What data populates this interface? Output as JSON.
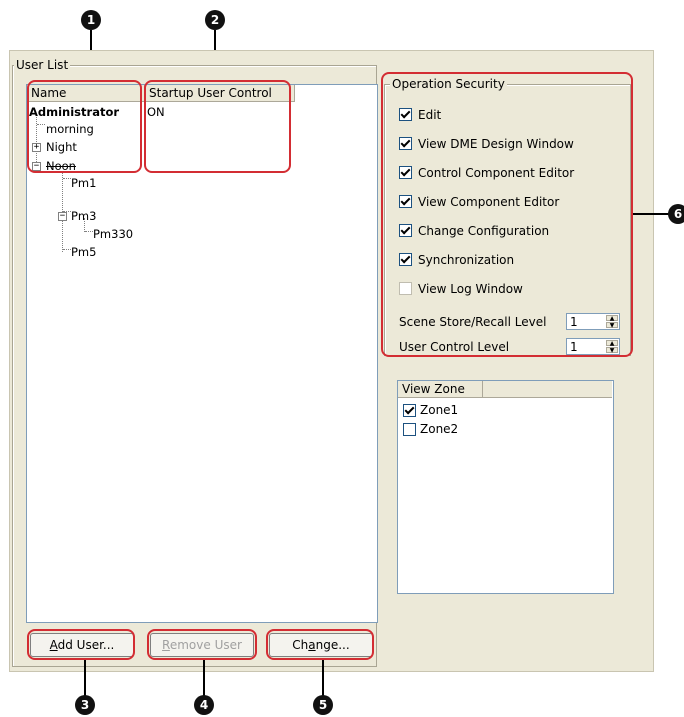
{
  "callouts": [
    "1",
    "2",
    "3",
    "4",
    "5",
    "6"
  ],
  "user_list": {
    "legend": "User List",
    "columns": [
      "Name",
      "Startup User Control"
    ],
    "rows": [
      {
        "name": "Administrator",
        "startup": "ON"
      },
      {
        "name": "morning",
        "startup": ""
      },
      {
        "name": "Night",
        "startup": ""
      },
      {
        "name": "Noon",
        "startup": ""
      },
      {
        "name": "Pm1",
        "startup": ""
      },
      {
        "name": "Pm3",
        "startup": ""
      },
      {
        "name": "Pm330",
        "startup": ""
      },
      {
        "name": "Pm5",
        "startup": ""
      }
    ],
    "expander_plus": "+",
    "expander_minus": "−"
  },
  "operation_security": {
    "legend": "Operation Security",
    "options": [
      {
        "label": "Edit",
        "checked": true
      },
      {
        "label": "View DME Design Window",
        "checked": true
      },
      {
        "label": "Control Component Editor",
        "checked": true
      },
      {
        "label": "View Component Editor",
        "checked": true
      },
      {
        "label": "Change Configuration",
        "checked": true
      },
      {
        "label": "Synchronization",
        "checked": true
      },
      {
        "label": "View Log Window",
        "checked": false
      }
    ],
    "scene_store_label": "Scene Store/Recall Level",
    "scene_store_value": "1",
    "user_control_label": "User Control Level",
    "user_control_value": "1"
  },
  "view_zone": {
    "header": "View Zone",
    "zones": [
      {
        "label": "Zone1",
        "checked": true
      },
      {
        "label": "Zone2",
        "checked": false
      }
    ]
  },
  "buttons": {
    "add_user_prefix": "A",
    "add_user_rest": "dd User...",
    "remove_user_prefix": "R",
    "remove_user_rest": "emove User",
    "change_prefix_a": "Ch",
    "change_u": "a",
    "change_rest": "nge..."
  },
  "colors": {
    "highlight": "#d32d33",
    "panel_bg": "#ece9d8",
    "list_border": "#7f9db9"
  },
  "icons": {
    "spin_up": "▲",
    "spin_down": "▼"
  }
}
